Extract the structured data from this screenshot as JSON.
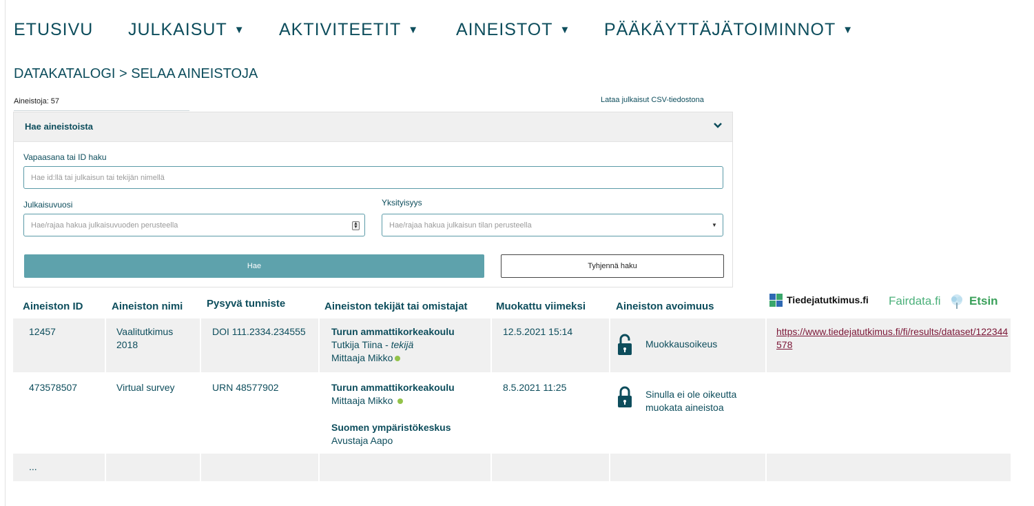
{
  "nav": {
    "items": [
      {
        "label": "ETUSIVU",
        "has_caret": false
      },
      {
        "label": "JULKAISUT",
        "has_caret": true
      },
      {
        "label": "AKTIVITEETIT",
        "has_caret": true
      },
      {
        "label": "AINEISTOT",
        "has_caret": true
      },
      {
        "label": "PÄÄKÄYTTÄJÄTOIMINNOT",
        "has_caret": true
      }
    ]
  },
  "breadcrumb": "DATAKATALOGI > SELAA AINEISTOJA",
  "count_label": "Aineistoja: 57",
  "csv_link": "Lataa julkaisut CSV-tiedostona",
  "search": {
    "title": "Hae aineistoista",
    "free_label": "Vapaasana tai ID haku",
    "free_placeholder": "Hae id:llä tai julkaisun tai tekijän nimellä",
    "year_label": "Julkaisuvuosi",
    "year_placeholder": "Hae/rajaa hakua julkaisuvuoden perusteella",
    "privacy_label": "Yksityisyys",
    "privacy_placeholder": "Hae/rajaa hakua julkaisun tilan perusteella",
    "search_button": "Hae",
    "clear_button": "Tyhjennä haku"
  },
  "logos": {
    "tiedejatutkimus": "Tiedejatutkimus.fi",
    "fairdata": "Fairdata.fi",
    "etsin": "Etsin",
    "colors": {
      "fairdata": "#4bb07a",
      "etsin": "#3aa05a"
    }
  },
  "table": {
    "headers": [
      "Aineiston ID",
      "Aineiston nimi",
      "Pysyvä tunniste",
      "Aineiston tekijät tai omistajat",
      "Muokattu viimeksi",
      "Aineiston avoimuus"
    ],
    "rows": [
      {
        "id": "12457",
        "name": "Vaalitutkimus 2018",
        "identifier": "DOI 111.2334.234555",
        "org1": "Turun ammattikorkeakoulu",
        "person1": "Tutkija Tiina - ",
        "person1_role": "tekijä",
        "person2": "Mittaaja Mikko",
        "modified": "12.5.2021 15:14",
        "access": "Muokkausoikeus",
        "link": "https://www.tiedejatutkimus.fi/fi/results/dataset/122344578"
      },
      {
        "id": "473578507",
        "name": "Virtual survey",
        "identifier": "URN 48577902",
        "org1": "Turun ammattikorkeakoulu",
        "person1": "Mittaaja Mikko",
        "org2": "Suomen ympäristökeskus",
        "person2": "Avustaja Aapo",
        "modified": "8.5.2021 11:25",
        "access": "Sinulla ei ole oikeutta muokata aineistoa"
      },
      {
        "id": "..."
      }
    ]
  },
  "colors": {
    "primary": "#0d4d5c",
    "button": "#5ea2ac",
    "row_bg": "#f0f0f0",
    "status_dot": "#93c34a",
    "link": "#7a1535"
  }
}
